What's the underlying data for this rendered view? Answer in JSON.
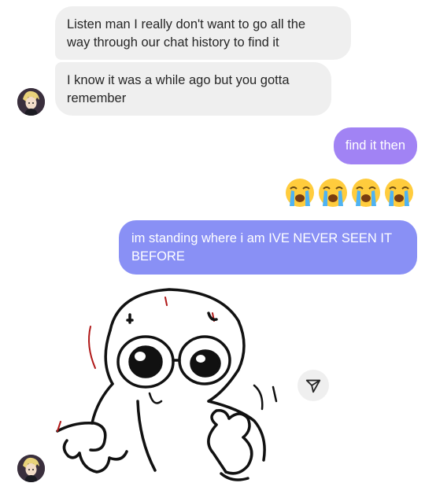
{
  "messages": [
    {
      "side": "incoming",
      "text": "Listen man I really don't want to go all the\nway through our chat history to find it"
    },
    {
      "side": "incoming",
      "text": "I know it was a while ago but you gotta\nremember"
    },
    {
      "side": "outgoing",
      "text": "find it then"
    },
    {
      "side": "outgoing",
      "type": "emoji",
      "emoji": [
        "😭",
        "😭",
        "😭",
        "😭"
      ]
    },
    {
      "side": "outgoing",
      "text": "im standing where i am IVE NEVER SEEN IT\nBEFORE"
    },
    {
      "side": "incoming",
      "type": "sticker",
      "sticker": "doodle-creature-sticker"
    }
  ],
  "icons": {
    "share": "send-paper-plane-icon",
    "avatar": "contact-avatar"
  },
  "colors": {
    "incoming_bubble": "#efefef",
    "outgoing_bubble_1": "#a183f4",
    "outgoing_bubble_2": "#8990f5",
    "text_dark": "#262626"
  }
}
